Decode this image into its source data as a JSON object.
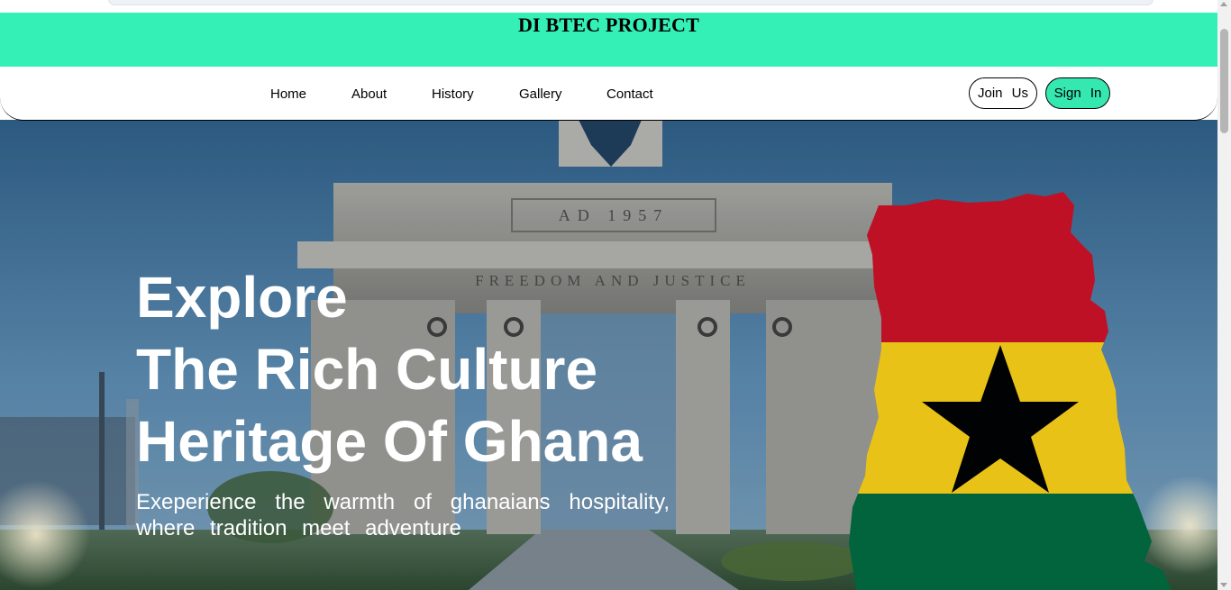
{
  "banner": {
    "title": "DI BTEC PROJECT",
    "color": "#35f0b6"
  },
  "nav": {
    "links": [
      "Home",
      "About",
      "History",
      "Gallery",
      "Contact"
    ],
    "join_label": "Join Us",
    "signin_label": "Sign In"
  },
  "hero": {
    "title_lines": [
      "Explore",
      "The Rich Culture",
      "Heritage Of Ghana"
    ],
    "subtitle_lines": [
      "Exeperience the warmth of ghanaians hospitality,",
      "where tradition meet adventure"
    ],
    "monument_inscriptions": [
      "AD 1957",
      "FREEDOM AND JUSTICE"
    ],
    "flag_colors": {
      "red": "#ce1126",
      "gold": "#fcd116",
      "green": "#006b3f",
      "star": "#000000"
    }
  },
  "scrollbar": {
    "up_icon": "arrow-up-icon",
    "down_icon": "arrow-down-icon"
  }
}
